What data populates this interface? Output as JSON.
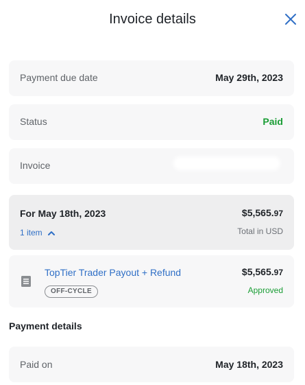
{
  "header": {
    "title": "Invoice details"
  },
  "due_date": {
    "label": "Payment due date",
    "value": "May 29th, 2023"
  },
  "status": {
    "label": "Status",
    "value": "Paid"
  },
  "invoice": {
    "label": "Invoice"
  },
  "period": {
    "label": "For May 18th, 2023",
    "amount_main": "$5,565.",
    "amount_cents": "97",
    "items_link": "1 item",
    "total_note": "Total in USD"
  },
  "line_item": {
    "name": "TopTier Trader Payout + Refund",
    "tag": "OFF-CYCLE",
    "amount_main": "$5,565.",
    "amount_cents": "97",
    "status": "Approved"
  },
  "payment_details": {
    "title": "Payment details",
    "paid_on_label": "Paid on",
    "paid_on_value": "May 18th, 2023"
  },
  "colors": {
    "accent": "#2f6fc6",
    "success": "#1a9d35",
    "card_bg": "#f7f7f8"
  }
}
